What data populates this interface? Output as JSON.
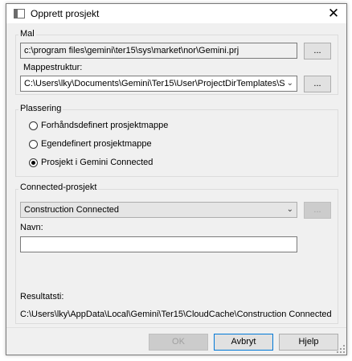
{
  "window": {
    "title": "Opprett prosjekt",
    "close_glyph": "✕"
  },
  "mal": {
    "group_label": "Mal",
    "template_path": "c:\\program files\\gemini\\ter15\\sys\\market\\nor\\Gemini.prj",
    "browse_label": "...",
    "folder_label": "Mappestruktur:",
    "folder_value": "C:\\Users\\lky\\Documents\\Gemini\\Ter15\\User\\ProjectDirTemplates\\S",
    "folder_browse_label": "..."
  },
  "plassering": {
    "group_label": "Plassering",
    "options": [
      {
        "label": "Forhåndsdefinert prosjektmappe",
        "checked": false
      },
      {
        "label": "Egendefinert prosjektmappe",
        "checked": false
      },
      {
        "label": "Prosjekt i Gemini Connected",
        "checked": true
      }
    ]
  },
  "connected": {
    "group_label": "Connected-prosjekt",
    "project_value": "Construction Connected",
    "browse_label": "...",
    "name_label": "Navn:",
    "name_value": "",
    "result_label": "Resultatsti:",
    "result_path": "C:\\Users\\lky\\AppData\\Local\\Gemini\\Ter15\\CloudCache\\Construction Connected"
  },
  "footer": {
    "ok_label": "OK",
    "cancel_label": "Avbryt",
    "help_label": "Hjelp"
  }
}
